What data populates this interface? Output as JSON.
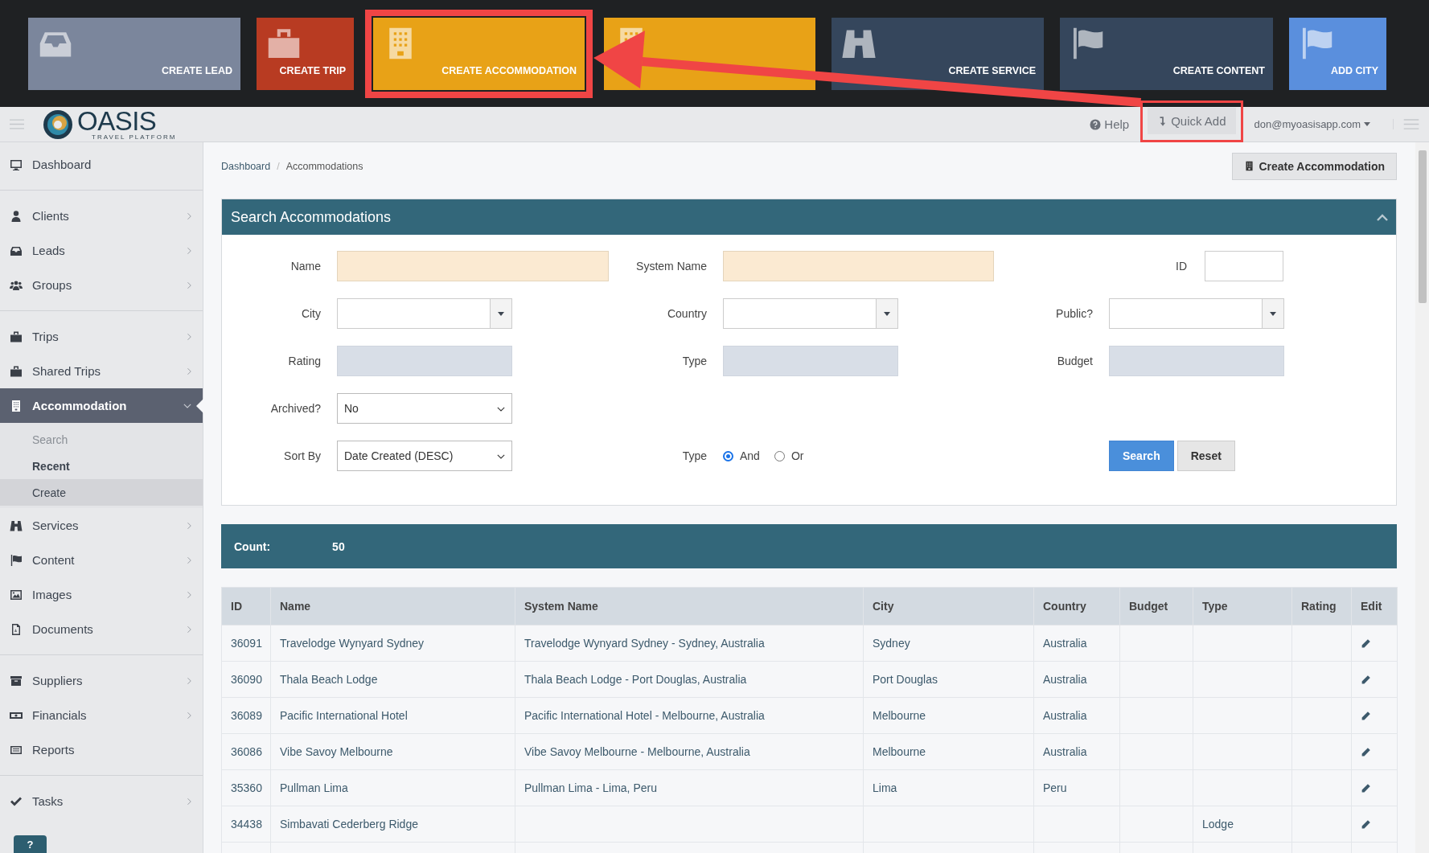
{
  "quick_add_panel": {
    "tiles": [
      {
        "label": "CREATE LEAD",
        "color": "#7b869c",
        "framed": false
      },
      {
        "label": "CREATE TRIP",
        "color": "#b83b22",
        "framed": false
      },
      {
        "label": "CREATE ACCOMMODATION",
        "color": "#e8a217",
        "framed": true
      },
      {
        "color": "#e8a217",
        "framed": false
      },
      {
        "label": "CREATE SERVICE",
        "color": "#35465c",
        "framed": false
      },
      {
        "label": "CREATE CONTENT",
        "color": "#35465c",
        "framed": false
      },
      {
        "label": "ADD CITY",
        "color": "#5a8fdd",
        "framed": false
      }
    ]
  },
  "header": {
    "logo": {
      "name": "OASIS",
      "tagline": "TRAVEL PLATFORM"
    },
    "help": "Help",
    "quick_add": {
      "label": "Quick Add",
      "framed": true
    },
    "user": "don@myoasisapp.com"
  },
  "sidebar": {
    "items": [
      {
        "label": "Dashboard",
        "submenu": false,
        "group_end": true
      },
      {
        "label": "Clients",
        "submenu": true,
        "group_end": false
      },
      {
        "label": "Leads",
        "submenu": true,
        "group_end": false
      },
      {
        "label": "Groups",
        "submenu": true,
        "group_end": true
      },
      {
        "label": "Trips",
        "submenu": true,
        "group_end": false
      },
      {
        "label": "Shared Trips",
        "submenu": true,
        "group_end": false
      },
      {
        "label": "Accommodation",
        "submenu": true,
        "group_end": false,
        "selected": true,
        "expanded": true,
        "children": [
          {
            "label": "Search",
            "selected": false,
            "hovered": false
          },
          {
            "label": "Recent",
            "selected": true,
            "hovered": false
          },
          {
            "label": "Create",
            "selected": false,
            "hovered": true
          }
        ]
      },
      {
        "label": "Services",
        "submenu": true,
        "group_end": false
      },
      {
        "label": "Content",
        "submenu": true,
        "group_end": false
      },
      {
        "label": "Images",
        "submenu": true,
        "group_end": false
      },
      {
        "label": "Documents",
        "submenu": true,
        "group_end": true
      },
      {
        "label": "Suppliers",
        "submenu": true,
        "group_end": false
      },
      {
        "label": "Financials",
        "submenu": true,
        "group_end": false
      },
      {
        "label": "Reports",
        "submenu": false,
        "group_end": true
      },
      {
        "label": "Tasks",
        "submenu": true,
        "group_end": false
      }
    ]
  },
  "help_button": "?",
  "breadcrumb": {
    "items": [
      "Dashboard",
      "Accommodations"
    ],
    "separator": "/"
  },
  "create_button": "Create Accommodation",
  "search_panel": {
    "title": "Search Accommodations",
    "rows": [
      [
        {
          "label": "Name",
          "kind": "text",
          "required": true
        },
        {
          "label": "System Name",
          "kind": "text",
          "required": true
        },
        {
          "label": "ID",
          "kind": "short"
        }
      ],
      [
        {
          "label": "City",
          "kind": "combo"
        },
        {
          "label": "Country",
          "kind": "combo"
        },
        {
          "label": "Public?",
          "kind": "combo"
        }
      ],
      [
        {
          "label": "Rating",
          "kind": "disabled"
        },
        {
          "label": "Type",
          "kind": "disabled"
        },
        {
          "label": "Budget",
          "kind": "disabled"
        }
      ],
      [
        {
          "label": "Archived?",
          "kind": "select",
          "value": "No"
        }
      ],
      [
        {
          "label": "Sort By",
          "kind": "select",
          "value": "Date Created (DESC)"
        },
        {
          "label": "Type",
          "kind": "radio",
          "options": [
            {
              "label": "And",
              "selected": true
            },
            {
              "label": "Or",
              "selected": false
            }
          ]
        },
        {
          "kind": "buttons",
          "buttons": [
            "Search",
            "Reset"
          ]
        }
      ]
    ]
  },
  "count": {
    "label": "Count:",
    "value": "50"
  },
  "table": {
    "columns": [
      {
        "label": "ID",
        "kind": "text"
      },
      {
        "label": "Name",
        "kind": "text"
      },
      {
        "label": "System Name",
        "kind": "text"
      },
      {
        "label": "City",
        "kind": "text"
      },
      {
        "label": "Country",
        "kind": "text"
      },
      {
        "label": "Budget",
        "kind": "text"
      },
      {
        "label": "Type",
        "kind": "text"
      },
      {
        "label": "Rating",
        "kind": "text"
      },
      {
        "label": "Edit",
        "kind": "edit"
      }
    ],
    "rows": [
      {
        "id": "36091",
        "name": "Travelodge Wynyard Sydney",
        "system_name": "Travelodge Wynyard Sydney - Sydney, Australia",
        "city": "Sydney",
        "country": "Australia"
      },
      {
        "id": "36090",
        "name": "Thala Beach Lodge",
        "system_name": "Thala Beach Lodge - Port Douglas, Australia",
        "city": "Port Douglas",
        "country": "Australia"
      },
      {
        "id": "36089",
        "name": "Pacific International Hotel",
        "system_name": "Pacific International Hotel - Melbourne, Australia",
        "city": "Melbourne",
        "country": "Australia"
      },
      {
        "id": "36086",
        "name": "Vibe Savoy Melbourne",
        "system_name": "Vibe Savoy Melbourne - Melbourne, Australia",
        "city": "Melbourne",
        "country": "Australia"
      },
      {
        "id": "35360",
        "name": "Pullman Lima",
        "system_name": "Pullman Lima - Lima, Peru",
        "city": "Lima",
        "country": "Peru"
      },
      {
        "id": "34438",
        "name": "Simbavati Cederberg Ridge",
        "type": "Lodge"
      }
    ]
  }
}
